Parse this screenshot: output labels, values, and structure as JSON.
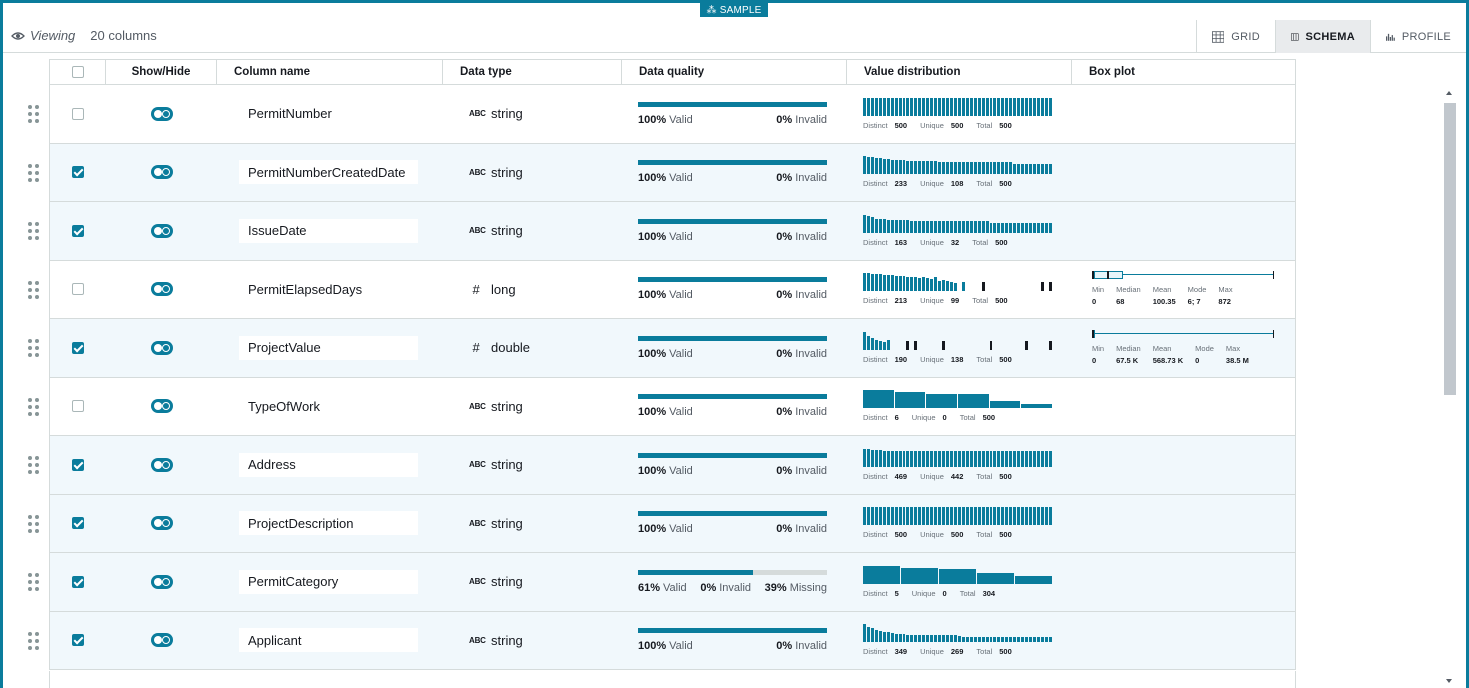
{
  "sample_tab": {
    "label": "SAMPLE",
    "icon": "sample-icon"
  },
  "viewing": {
    "label": "Viewing",
    "count": "20 columns",
    "icon": "eye-icon"
  },
  "view_tabs": [
    {
      "label": "GRID",
      "icon": "grid-icon",
      "active": false
    },
    {
      "label": "SCHEMA",
      "icon": "schema-icon",
      "active": true
    },
    {
      "label": "PROFILE",
      "icon": "profile-icon",
      "active": false
    }
  ],
  "headers": {
    "show_hide": "Show/Hide",
    "column_name": "Column name",
    "data_type": "Data type",
    "data_quality": "Data quality",
    "value_distribution": "Value distribution",
    "box_plot": "Box plot"
  },
  "labels": {
    "valid": "Valid",
    "invalid": "Invalid",
    "missing": "Missing",
    "distinct": "Distinct",
    "unique": "Unique",
    "total": "Total",
    "min": "Min",
    "median": "Median",
    "mean": "Mean",
    "mode": "Mode",
    "max": "Max",
    "type_icon_string": "ABC",
    "type_icon_number": "#"
  },
  "colors": {
    "accent": "#0a7c9c",
    "selected_row": "#f1f8fc"
  },
  "rows": [
    {
      "name": "PermitNumber",
      "checked": false,
      "type": "string",
      "type_icon": "string",
      "dq": {
        "valid": "100%",
        "invalid": "0%",
        "missing": null,
        "valid_fraction": 1.0
      },
      "dist": {
        "distinct": "500",
        "unique": "500",
        "total": "500"
      },
      "hist": {
        "style": "uniform",
        "bins": [
          1,
          1,
          1,
          1,
          1,
          1,
          1,
          1,
          1,
          1,
          1,
          1,
          1,
          1,
          1,
          1,
          1,
          1,
          1,
          1,
          1,
          1,
          1,
          1,
          1,
          1,
          1,
          1,
          1,
          1,
          1,
          1,
          1,
          1,
          1,
          1,
          1,
          1,
          1,
          1,
          1,
          1,
          1,
          1,
          1,
          1,
          1,
          1
        ]
      },
      "box": null
    },
    {
      "name": "PermitNumberCreatedDate",
      "checked": true,
      "type": "string",
      "type_icon": "string",
      "dq": {
        "valid": "100%",
        "invalid": "0%",
        "missing": null,
        "valid_fraction": 1.0
      },
      "dist": {
        "distinct": "233",
        "unique": "108",
        "total": "500"
      },
      "hist": {
        "style": "uniform",
        "bins": [
          1,
          0.95,
          0.92,
          0.9,
          0.88,
          0.85,
          0.82,
          0.8,
          0.78,
          0.76,
          0.75,
          0.74,
          0.73,
          0.72,
          0.72,
          0.71,
          0.7,
          0.7,
          0.7,
          0.69,
          0.69,
          0.69,
          0.68,
          0.68,
          0.68,
          0.68,
          0.67,
          0.67,
          0.67,
          0.67,
          0.66,
          0.66,
          0.66,
          0.66,
          0.66,
          0.65,
          0.65,
          0.65,
          0.55,
          0.55,
          0.55,
          0.55,
          0.55,
          0.55,
          0.55,
          0.55,
          0.55,
          0.55
        ]
      },
      "box": null
    },
    {
      "name": "IssueDate",
      "checked": true,
      "type": "string",
      "type_icon": "string",
      "dq": {
        "valid": "100%",
        "invalid": "0%",
        "missing": null,
        "valid_fraction": 1.0
      },
      "dist": {
        "distinct": "163",
        "unique": "32",
        "total": "500"
      },
      "hist": {
        "style": "uniform",
        "bins": [
          1,
          0.95,
          0.88,
          0.8,
          0.78,
          0.76,
          0.74,
          0.72,
          0.72,
          0.71,
          0.7,
          0.7,
          0.69,
          0.69,
          0.69,
          0.68,
          0.68,
          0.68,
          0.68,
          0.67,
          0.67,
          0.67,
          0.67,
          0.66,
          0.66,
          0.66,
          0.66,
          0.66,
          0.65,
          0.65,
          0.65,
          0.65,
          0.55,
          0.55,
          0.55,
          0.55,
          0.55,
          0.55,
          0.55,
          0.55,
          0.55,
          0.55,
          0.55,
          0.55,
          0.55,
          0.55,
          0.55,
          0.55
        ]
      },
      "box": null
    },
    {
      "name": "PermitElapsedDays",
      "checked": false,
      "type": "long",
      "type_icon": "number",
      "dq": {
        "valid": "100%",
        "invalid": "0%",
        "missing": null,
        "valid_fraction": 1.0
      },
      "dist": {
        "distinct": "213",
        "unique": "99",
        "total": "500"
      },
      "hist": {
        "style": "mixed",
        "bins": [
          1,
          1,
          0.95,
          0.95,
          0.92,
          0.9,
          0.9,
          0.88,
          0.85,
          0.85,
          0.82,
          0.8,
          0.78,
          0.75,
          0.72,
          0.8,
          0.7,
          0.65,
          0.75,
          0.55,
          0.6,
          0.55,
          0.5,
          0.45,
          0,
          0.5,
          0,
          0,
          0,
          0,
          0.5,
          0,
          0,
          0,
          0,
          0,
          0,
          0,
          0,
          0,
          0,
          0,
          0,
          0,
          0,
          0.5,
          0,
          0.5
        ],
        "dark": [
          24,
          26,
          30,
          45,
          47
        ]
      },
      "box": {
        "min": "0",
        "median": "68",
        "mean": "100.35",
        "mode": "6; 7",
        "max": "872",
        "q1_frac": 0.01,
        "q3_frac": 0.17,
        "median_frac": 0.08
      }
    },
    {
      "name": "ProjectValue",
      "checked": true,
      "type": "double",
      "type_icon": "number",
      "dq": {
        "valid": "100%",
        "invalid": "0%",
        "missing": null,
        "valid_fraction": 1.0
      },
      "dist": {
        "distinct": "190",
        "unique": "138",
        "total": "500"
      },
      "hist": {
        "style": "mixed",
        "bins": [
          1,
          0.75,
          0.65,
          0.55,
          0.5,
          0.45,
          0.55,
          0,
          0,
          0,
          0,
          0.5,
          0,
          0.5,
          0,
          0,
          0,
          0,
          0,
          0,
          0.5,
          0,
          0,
          0,
          0,
          0,
          0,
          0,
          0,
          0,
          0,
          0,
          0.5,
          0,
          0,
          0,
          0,
          0,
          0,
          0,
          0,
          0.5,
          0,
          0,
          0,
          0,
          0,
          0.5
        ],
        "dark": [
          11,
          13,
          20,
          32,
          41,
          47
        ]
      },
      "box": {
        "min": "0",
        "median": "67.5 K",
        "mean": "568.73 K",
        "mode": "0",
        "max": "38.5 M",
        "q1_frac": 0.0,
        "q3_frac": 0.005,
        "median_frac": 0.002
      }
    },
    {
      "name": "TypeOfWork",
      "checked": false,
      "type": "string",
      "type_icon": "string",
      "dq": {
        "valid": "100%",
        "invalid": "0%",
        "missing": null,
        "valid_fraction": 1.0
      },
      "dist": {
        "distinct": "6",
        "unique": "0",
        "total": "500"
      },
      "hist": {
        "style": "blocks",
        "bins": [
          1,
          0.88,
          0.8,
          0.75,
          0.38,
          0.2
        ]
      },
      "box": null
    },
    {
      "name": "Address",
      "checked": true,
      "type": "string",
      "type_icon": "string",
      "dq": {
        "valid": "100%",
        "invalid": "0%",
        "missing": null,
        "valid_fraction": 1.0
      },
      "dist": {
        "distinct": "469",
        "unique": "442",
        "total": "500"
      },
      "hist": {
        "style": "uniform",
        "bins": [
          1,
          1,
          0.95,
          0.92,
          0.92,
          0.9,
          0.9,
          0.9,
          0.9,
          0.88,
          0.88,
          0.88,
          0.88,
          0.88,
          0.88,
          0.88,
          0.88,
          0.88,
          0.88,
          0.88,
          0.88,
          0.88,
          0.88,
          0.88,
          0.88,
          0.88,
          0.88,
          0.88,
          0.88,
          0.88,
          0.88,
          0.88,
          0.88,
          0.88,
          0.88,
          0.88,
          0.88,
          0.88,
          0.88,
          0.88,
          0.88,
          0.88,
          0.88,
          0.88,
          0.88,
          0.88,
          0.88,
          0.88
        ]
      },
      "box": null
    },
    {
      "name": "ProjectDescription",
      "checked": true,
      "type": "string",
      "type_icon": "string",
      "dq": {
        "valid": "100%",
        "invalid": "0%",
        "missing": null,
        "valid_fraction": 1.0
      },
      "dist": {
        "distinct": "500",
        "unique": "500",
        "total": "500"
      },
      "hist": {
        "style": "uniform",
        "bins": [
          1,
          1,
          1,
          1,
          1,
          1,
          1,
          1,
          1,
          1,
          1,
          1,
          1,
          1,
          1,
          1,
          1,
          1,
          1,
          1,
          1,
          1,
          1,
          1,
          1,
          1,
          1,
          1,
          1,
          1,
          1,
          1,
          1,
          1,
          1,
          1,
          1,
          1,
          1,
          1,
          1,
          1,
          1,
          1,
          1,
          1,
          1,
          1
        ]
      },
      "box": null
    },
    {
      "name": "PermitCategory",
      "checked": true,
      "type": "string",
      "type_icon": "string",
      "dq": {
        "valid": "61%",
        "invalid": "0%",
        "missing": "39%",
        "valid_fraction": 0.61
      },
      "dist": {
        "distinct": "5",
        "unique": "0",
        "total": "304"
      },
      "hist": {
        "style": "blocks",
        "bins": [
          1,
          0.9,
          0.82,
          0.62,
          0.45
        ]
      },
      "box": null
    },
    {
      "name": "Applicant",
      "checked": true,
      "type": "string",
      "type_icon": "string",
      "dq": {
        "valid": "100%",
        "invalid": "0%",
        "missing": null,
        "valid_fraction": 1.0
      },
      "dist": {
        "distinct": "349",
        "unique": "269",
        "total": "500"
      },
      "hist": {
        "style": "uniform",
        "bins": [
          1,
          0.85,
          0.75,
          0.65,
          0.6,
          0.55,
          0.55,
          0.5,
          0.45,
          0.45,
          0.45,
          0.4,
          0.4,
          0.4,
          0.4,
          0.4,
          0.4,
          0.4,
          0.4,
          0.4,
          0.4,
          0.4,
          0.38,
          0.38,
          0.35,
          0.3,
          0.3,
          0.3,
          0.3,
          0.3,
          0.3,
          0.3,
          0.3,
          0.3,
          0.3,
          0.3,
          0.3,
          0.3,
          0.3,
          0.3,
          0.3,
          0.3,
          0.3,
          0.3,
          0.3,
          0.3,
          0.3,
          0.3
        ]
      },
      "box": null
    }
  ]
}
